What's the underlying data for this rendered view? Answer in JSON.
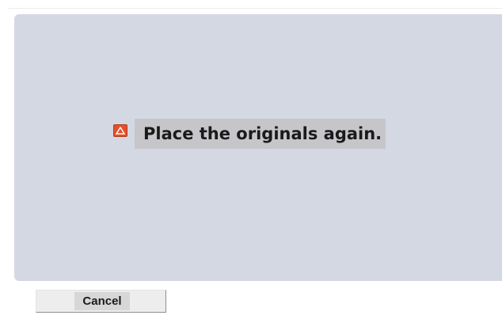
{
  "message": {
    "icon": "warning-icon",
    "icon_color": "#e4502c",
    "text": "Place the originals again."
  },
  "actions": {
    "cancel_label": "Cancel"
  },
  "colors": {
    "panel_background": "#d4d8e3",
    "message_background": "#c6c6ca",
    "button_background": "#ededed"
  }
}
